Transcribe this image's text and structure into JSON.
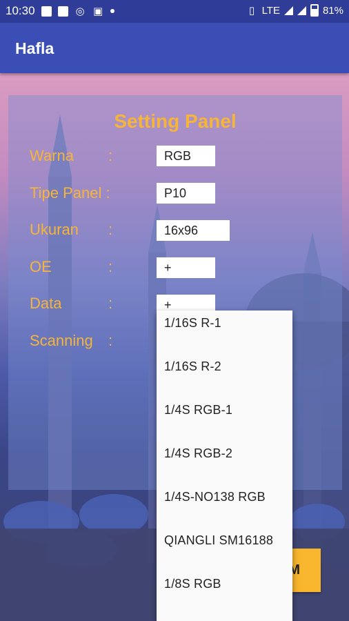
{
  "status_bar": {
    "time": "10:30",
    "network": "LTE",
    "battery": "81%",
    "left_icons": [
      "image-icon",
      "document-icon",
      "whatsapp-icon",
      "robot-icon",
      "dot-icon"
    ],
    "right_icons": [
      "vibrate-icon",
      "lte-icon",
      "signal-icon",
      "signal-icon",
      "battery-icon"
    ]
  },
  "app_bar": {
    "title": "Hafla"
  },
  "panel": {
    "title": "Setting Panel",
    "colon": ":",
    "rows": [
      {
        "label": "Warna",
        "value": "RGB"
      },
      {
        "label": "Tipe Panel :",
        "value": "P10"
      },
      {
        "label": "Ukuran",
        "value": "16x96"
      },
      {
        "label": "OE",
        "value": "+"
      },
      {
        "label": "Data",
        "value": "+"
      },
      {
        "label": "Scanning",
        "value": ""
      }
    ]
  },
  "action_button": {
    "label": "M"
  },
  "dropdown": {
    "options": [
      "1/16S R-1",
      "1/16S R-2",
      "1/4S RGB-1",
      "1/4S RGB-2",
      "1/4S-NO138 RGB",
      "QIANGLI SM16188",
      "1/8S RGB"
    ]
  },
  "colors": {
    "status_bar": "#2f3d99",
    "app_bar": "#3a4eb6",
    "accent_text": "#f5b53a",
    "button": "#f8b52e"
  }
}
